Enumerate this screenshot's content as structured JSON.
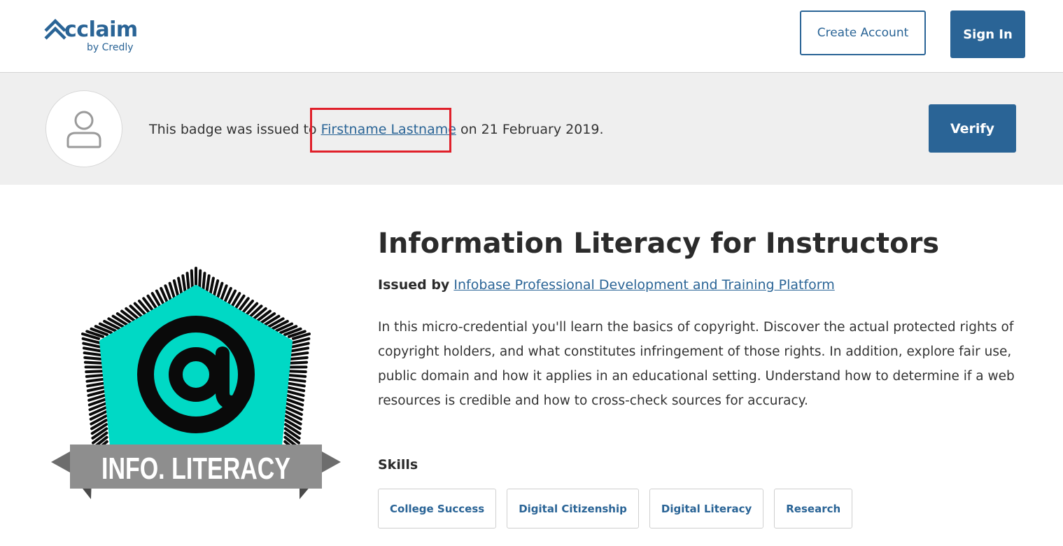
{
  "header": {
    "logo_word": "cclaim",
    "logo_sub": "by Credly",
    "create_account_label": "Create Account",
    "sign_in_label": "Sign In"
  },
  "issued": {
    "prefix": "This badge was issued to ",
    "recipient": "Firstname Lastname",
    "suffix": " on 21 February 2019.",
    "verify_label": "Verify"
  },
  "badge": {
    "title": "Information Literacy for Instructors",
    "issued_by_label": "Issued by",
    "issuer": "Infobase Professional Development and Training Platform",
    "description": "In this micro-credential you'll learn the basics of copyright. Discover the actual protected rights of copyright holders, and what constitutes infringement of those rights. In addition, explore fair use, public domain and how it applies in an educational setting. Understand how to determine if a web resources is credible and how to cross-check sources for accuracy.",
    "image_banner": "INFO. LITERACY",
    "image_symbol": "@"
  },
  "skills": {
    "heading": "Skills",
    "items": [
      "College Success",
      "Digital Citizenship",
      "Digital Literacy",
      "Research"
    ]
  },
  "colors": {
    "brand": "#2a6496",
    "badge_teal": "#00d9c5",
    "highlight": "#e0202a"
  }
}
